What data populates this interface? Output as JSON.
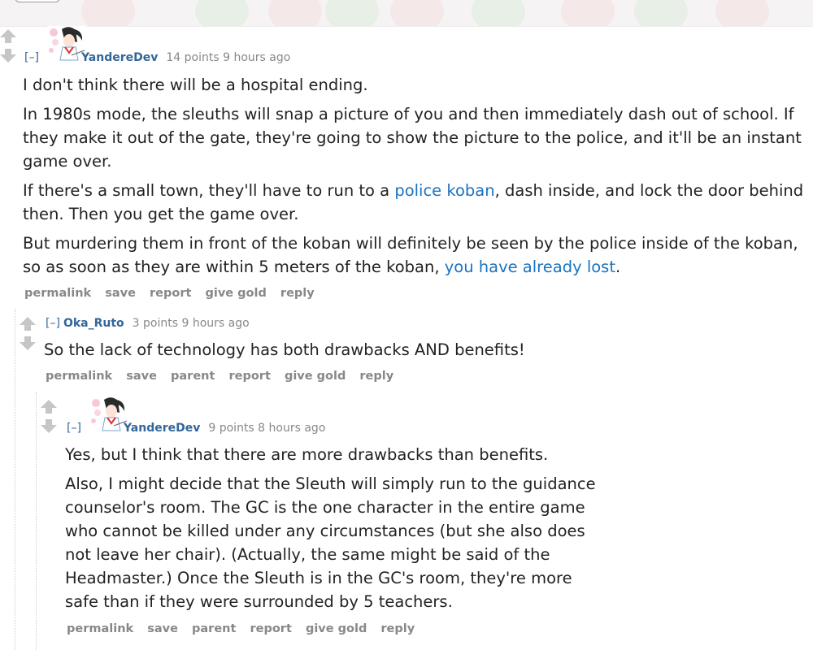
{
  "comments": [
    {
      "expand": "[–]",
      "author": "YandereDev",
      "score": "14 points 9 hours ago",
      "has_avatar": true,
      "paragraphs": [
        [
          "I don't think there will be a hospital ending."
        ],
        [
          "In 1980s mode, the sleuths will snap a picture of you and then immediately dash out of school. If they make it out of the gate, they're going to show the picture to the police, and it'll be an instant game over."
        ],
        [
          "If there's a small town, they'll have to run to a ",
          "police koban",
          ", dash inside, and lock the door behind then. Then you get the game over."
        ],
        [
          "But murdering them in front of the koban will definitely be seen by the police inside of the koban, so as soon as they are within 5 meters of the koban, ",
          "you have already lost",
          "."
        ]
      ],
      "buttons": [
        "permalink",
        "save",
        "report",
        "give gold",
        "reply"
      ]
    },
    {
      "expand": "[–]",
      "author": "Oka_Ruto",
      "score": "3 points 9 hours ago",
      "has_avatar": false,
      "paragraphs": [
        [
          "So the lack of technology has both drawbacks AND benefits!"
        ]
      ],
      "buttons": [
        "permalink",
        "save",
        "parent",
        "report",
        "give gold",
        "reply"
      ]
    },
    {
      "expand": "[–]",
      "author": "YandereDev",
      "score": "9 points 8 hours ago",
      "has_avatar": true,
      "paragraphs": [
        [
          "Yes, but I think that there are more drawbacks than benefits."
        ],
        [
          "Also, I might decide that the Sleuth will simply run to the guidance counselor's room. The GC is the one character in the entire game who cannot be killed under any circumstances (but she also does not leave her chair). (Actually, the same might be said of the Headmaster.) Once the Sleuth is in the GC's room, they're more safe than if they were surrounded by 5 teachers."
        ]
      ],
      "buttons": [
        "permalink",
        "save",
        "parent",
        "report",
        "give gold",
        "reply"
      ]
    }
  ],
  "colors": {
    "link": "#1a73c0",
    "author": "#336699",
    "meta": "#888888",
    "text": "#222222"
  },
  "icons": [
    "upvote-arrow-icon",
    "downvote-arrow-icon",
    "anime-avatar-icon"
  ]
}
